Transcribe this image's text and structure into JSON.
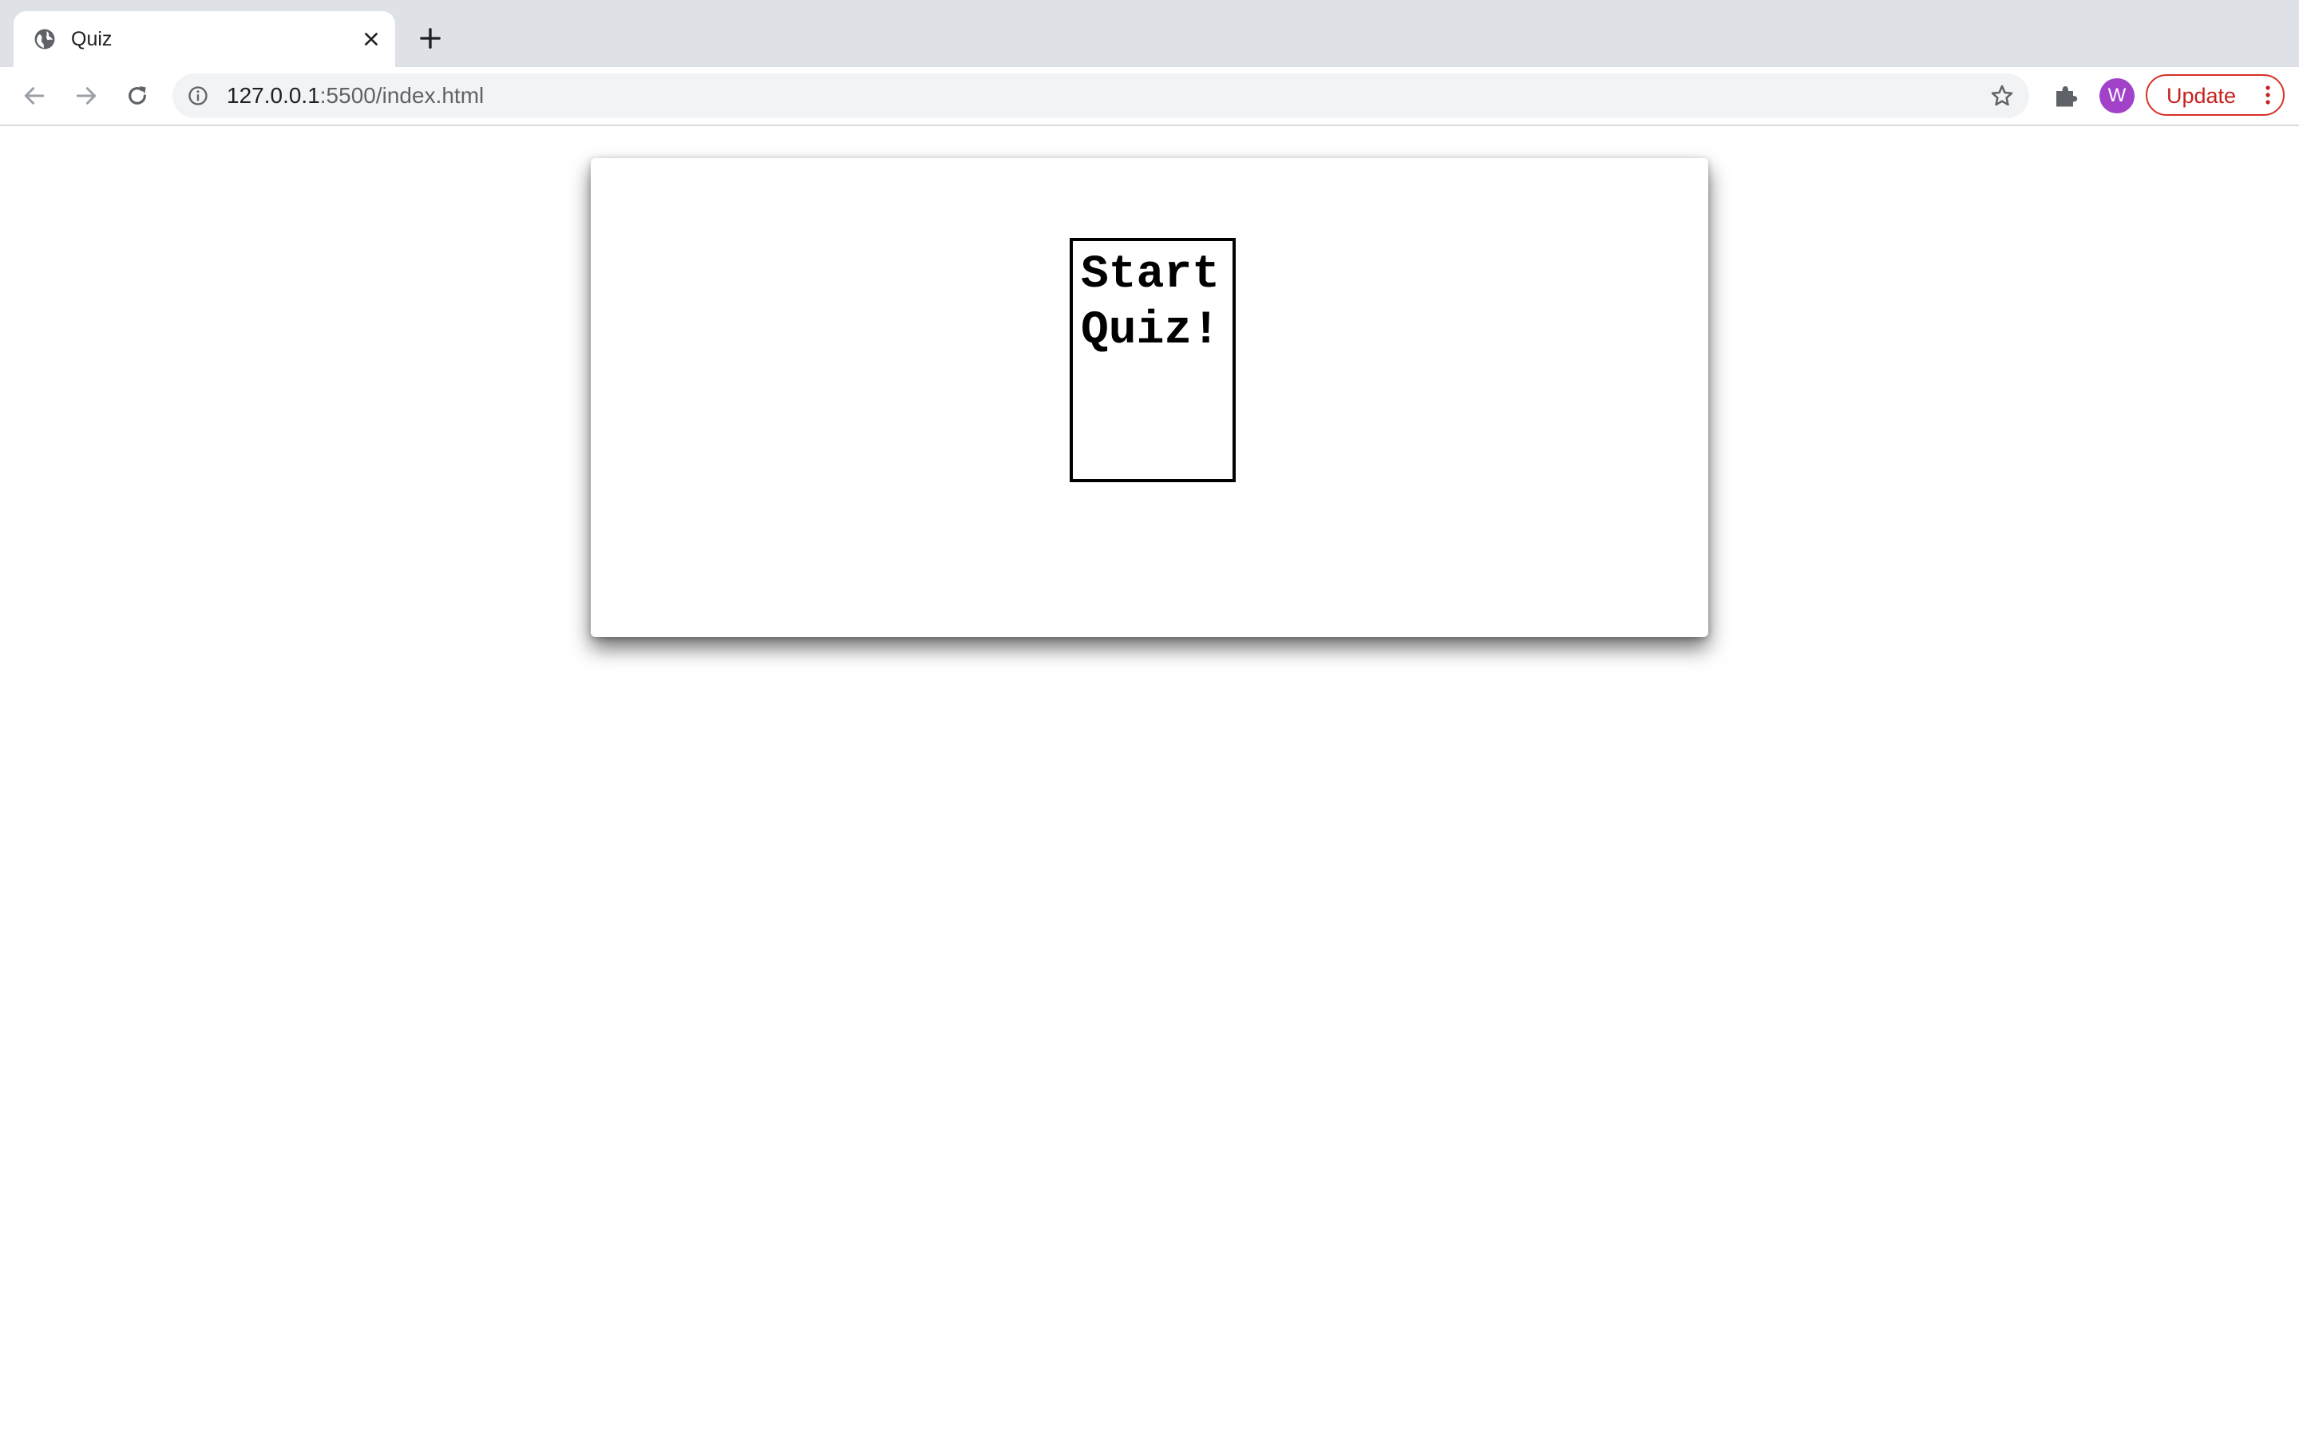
{
  "browser": {
    "tab": {
      "title": "Quiz",
      "favicon": "globe-icon",
      "close_icon": "close-icon"
    },
    "new_tab_icon": "plus-icon",
    "nav": {
      "back_icon": "back-arrow-icon",
      "forward_icon": "forward-arrow-icon",
      "reload_icon": "reload-icon"
    },
    "address": {
      "host": "127.0.0.1",
      "path": ":5500/index.html",
      "info_icon": "info-icon",
      "bookmark_icon": "star-icon"
    },
    "extensions_icon": "puzzle-icon",
    "profile": {
      "initial": "W",
      "color": "#a142c8"
    },
    "update": {
      "label": "Update",
      "color": "#d93025",
      "menu_icon": "kebab-menu-icon"
    }
  },
  "page": {
    "start_button": {
      "label": "Start Quiz!"
    }
  }
}
